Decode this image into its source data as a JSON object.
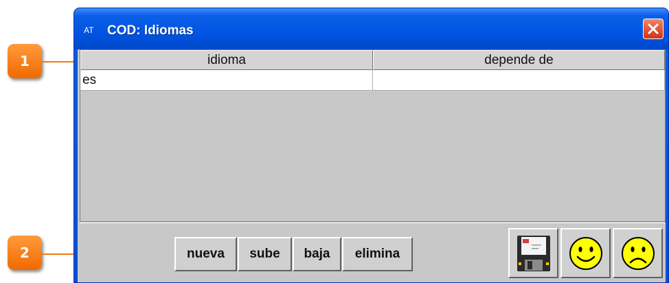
{
  "callouts": [
    {
      "label": "1"
    },
    {
      "label": "2"
    }
  ],
  "window": {
    "app_icon_text": "AT",
    "title": "COD: Idiomas"
  },
  "table": {
    "columns": [
      "idioma",
      "depende de"
    ],
    "rows": [
      [
        "es",
        ""
      ]
    ]
  },
  "toolbar": {
    "buttons": [
      "nueva",
      "sube",
      "baja",
      "elimina"
    ],
    "icons": [
      "save-disk-icon",
      "happy-face-icon",
      "sad-face-icon"
    ]
  },
  "colors": {
    "titlebar": "#0054e3",
    "callout": "#f07a10",
    "close_button": "#e05030",
    "client_bg": "#c8c8c8"
  }
}
